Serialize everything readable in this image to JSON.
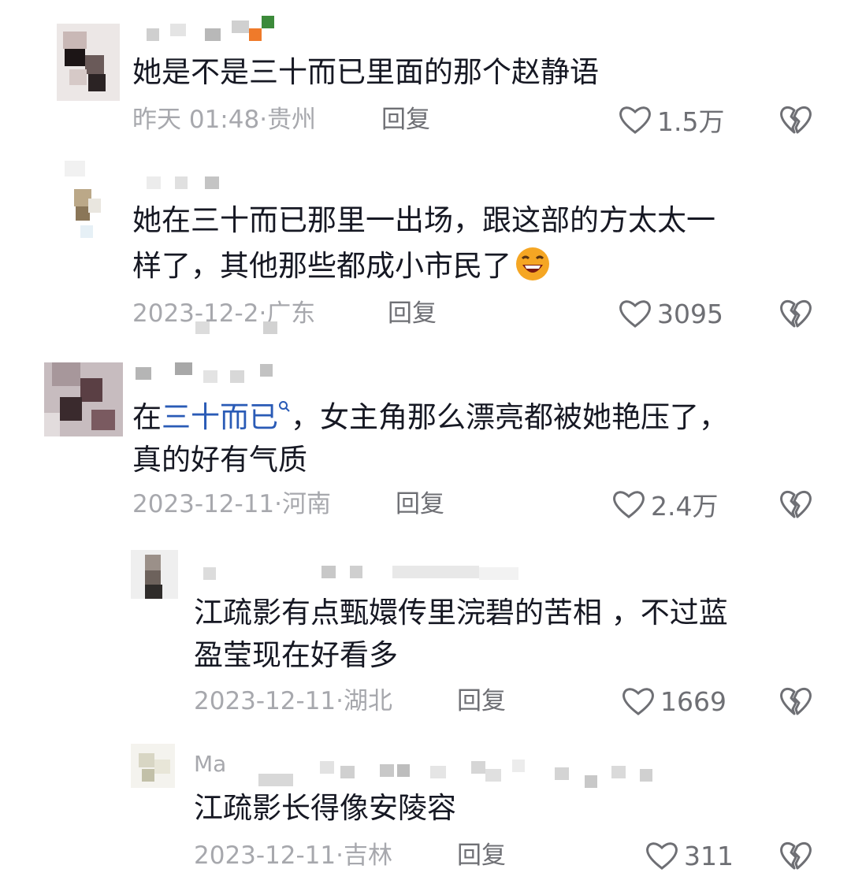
{
  "comments": [
    {
      "body_lines": [
        "她是不是三十而已里面的那个赵静语"
      ],
      "date": "昨天 01:48",
      "location": "贵州",
      "reply_label": "回复",
      "likes": "1.5万"
    },
    {
      "body_lines": [
        "她在三十而已那里一出场，跟这部的方太太一",
        "样了，其他那些都成小市民了"
      ],
      "date": "2023-12-2",
      "location": "广东",
      "reply_label": "回复",
      "likes": "3095"
    },
    {
      "body_prefix": "在",
      "body_link": "三十而已",
      "body_suffix": "，女主角那么漂亮都被她艳压了，",
      "body_line2": "真的好有气质",
      "date": "2023-12-11",
      "location": "河南",
      "reply_label": "回复",
      "likes": "2.4万"
    },
    {
      "body_lines": [
        "江疏影有点甄嬛传里浣碧的苦相 ，不过蓝",
        "盈莹现在好看多"
      ],
      "date": "2023-12-11",
      "location": "湖北",
      "reply_label": "回复",
      "likes": "1669"
    },
    {
      "username_visible": "Ma",
      "body_lines": [
        "江疏影长得像安陵容"
      ],
      "date": "2023-12-11",
      "location": "吉林",
      "reply_label": "回复",
      "likes": "311"
    }
  ],
  "meta_separator": "·",
  "colors": {
    "link": "#2a5bb6",
    "meta": "#a7a8ad",
    "text": "#161823"
  }
}
